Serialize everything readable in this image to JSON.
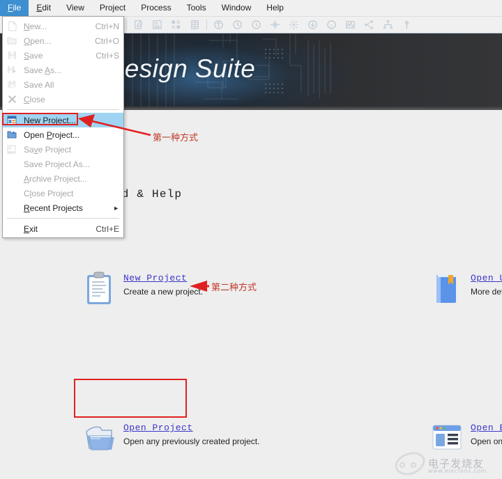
{
  "window": {
    "app_title": "Vivado Design Suite",
    "banner_title_visible": "o Design Suite"
  },
  "menubar": {
    "items": [
      {
        "label": "File",
        "accel_index": 0,
        "active": true
      },
      {
        "label": "Edit",
        "accel_index": 0,
        "active": false
      },
      {
        "label": "View",
        "accel_index": 0,
        "active": false
      },
      {
        "label": "Project",
        "accel_index": 0,
        "active": false
      },
      {
        "label": "Process",
        "accel_index": 1,
        "active": false
      },
      {
        "label": "Tools",
        "accel_index": 0,
        "active": false
      },
      {
        "label": "Window",
        "accel_index": 0,
        "active": false
      },
      {
        "label": "Help",
        "accel_index": 0,
        "active": false
      }
    ]
  },
  "toolbar": {
    "icons": [
      "new-file-icon",
      "save-icon",
      "search-icon",
      "run-icon",
      "pause-icon",
      "settings-gear-icon",
      "edit-note-icon",
      "report-icon",
      "schematic-icon",
      "table-icon",
      "synthesis-icon",
      "implementation-icon",
      "timing-icon",
      "bitstream-icon",
      "power-icon",
      "download-icon",
      "copyright-icon",
      "waveform-icon",
      "netlist-icon",
      "hierarchy-icon",
      "pin-icon"
    ]
  },
  "file_menu": {
    "groups": [
      [
        {
          "label": "New...",
          "accel": "Ctrl+N",
          "icon": "new-file-icon",
          "disabled": true,
          "selected": false,
          "underline": 0
        },
        {
          "label": "Open...",
          "accel": "Ctrl+O",
          "icon": "open-folder-icon",
          "disabled": true,
          "selected": false,
          "underline": 0
        },
        {
          "label": "Save",
          "accel": "Ctrl+S",
          "icon": "save-disk-icon",
          "disabled": true,
          "selected": false,
          "underline": 0
        },
        {
          "label": "Save As...",
          "accel": "",
          "icon": "save-as-icon",
          "disabled": true,
          "selected": false,
          "underline": 5
        },
        {
          "label": "Save All",
          "accel": "",
          "icon": "save-all-icon",
          "disabled": true,
          "selected": false,
          "underline": -1
        },
        {
          "label": "Close",
          "accel": "",
          "icon": "close-x-icon",
          "disabled": true,
          "selected": false,
          "underline": 0
        }
      ],
      [
        {
          "label": "New Project...",
          "accel": "",
          "icon": "new-project-icon",
          "disabled": false,
          "selected": true,
          "underline": 5
        },
        {
          "label": "Open Project...",
          "accel": "",
          "icon": "open-project-icon",
          "disabled": false,
          "selected": false,
          "underline": 5
        },
        {
          "label": "Save Project",
          "accel": "",
          "icon": "save-project-icon",
          "disabled": true,
          "selected": false,
          "underline": 2
        },
        {
          "label": "Save Project As...",
          "accel": "",
          "icon": "",
          "disabled": true,
          "selected": false,
          "underline": -1
        },
        {
          "label": "Archive Project...",
          "accel": "",
          "icon": "",
          "disabled": true,
          "selected": false,
          "underline": 0
        },
        {
          "label": "Close Project",
          "accel": "",
          "icon": "",
          "disabled": true,
          "selected": false,
          "underline": 1
        },
        {
          "label": "Recent Projects",
          "accel": "",
          "icon": "",
          "disabled": false,
          "selected": false,
          "underline": 0,
          "submenu": true
        }
      ],
      [
        {
          "label": "Exit",
          "accel": "Ctrl+E",
          "icon": "",
          "disabled": false,
          "selected": false,
          "underline": 0
        }
      ]
    ]
  },
  "main": {
    "section_title": "Started & Help",
    "cards": [
      {
        "id": "new-project",
        "link": "New Project",
        "desc": "Create a new project.",
        "icon": "clipboard-icon"
      },
      {
        "id": "open-user-guide",
        "link": "Open U",
        "desc": "More deta",
        "icon": "book-icon"
      },
      {
        "id": "open-project",
        "link": "Open Project",
        "desc": "Open any previously created project.",
        "icon": "open-folder-card-icon"
      },
      {
        "id": "open-example-project",
        "link": "Open E",
        "desc": "Open one",
        "icon": "window-layout-icon"
      }
    ]
  },
  "annotations": [
    {
      "id": "anno-1",
      "text": "第一种方式",
      "color": "#c0392b"
    },
    {
      "id": "anno-2",
      "text": "第二种方式",
      "color": "#c0392b"
    }
  ],
  "watermark": {
    "text": "电子发烧友",
    "sub": "www.elecfans.com"
  },
  "colors": {
    "menu_highlight": "#3c8fd0",
    "menu_selected_row": "#9fd4f3",
    "annotation_red": "#e02020",
    "link_blue": "#3a34c8",
    "surface": "#eeeeee",
    "banner_dark": "#202124",
    "banner_glow": "#3c76aa"
  }
}
